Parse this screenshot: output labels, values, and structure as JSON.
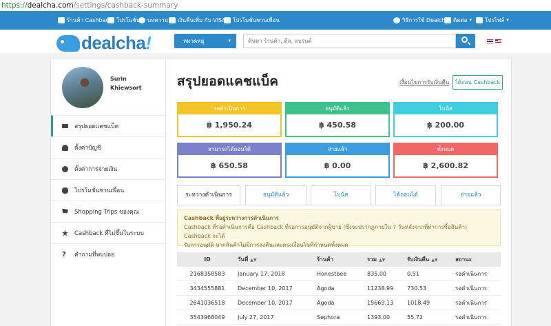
{
  "browser": {
    "url_scheme": "https://",
    "url_host": "dealcha.com",
    "url_path": "/settings/cashback-summary"
  },
  "topnav": {
    "items": [
      {
        "label": "ร้านค้า Cashback",
        "icon": "store-icon"
      },
      {
        "label": "โปรโมชั่น",
        "icon": "tag-icon"
      },
      {
        "label": "บทความ",
        "icon": "bulb-icon"
      },
      {
        "label": "เงินคืนเพิ่ม กับ VISA",
        "icon": "card-icon"
      },
      {
        "label": "โปรโมชั่นชวนเพื่อน",
        "icon": "gift-icon"
      }
    ],
    "right": [
      {
        "label": "วิธีการใช้ Dealcha!",
        "icon": "help-icon"
      },
      {
        "label": "ติดต่อ",
        "icon": "mail-icon"
      },
      {
        "label": "โปรไฟล์",
        "icon": "user-icon"
      }
    ]
  },
  "header": {
    "logo_main": "dealcha",
    "logo_bang": "!",
    "category_label": "หมวดหมู่",
    "search_placeholder": "ค้นหา ร้านค้า, ดีล, แบรนด์"
  },
  "user": {
    "first_name": "Surin",
    "last_name": "Khiewsort"
  },
  "sidebar": {
    "items": [
      {
        "label": "สรุปยอดแคชแบ็ค",
        "icon": "money-icon"
      },
      {
        "label": "ตั้งค่าบัญชี",
        "icon": "user-icon"
      },
      {
        "label": "ตั้งค่าการจ่ายเงิน",
        "icon": "gear-icon"
      },
      {
        "label": "โปรโมชั่นชวนเพื่อน",
        "icon": "chat-icon"
      },
      {
        "label": "Shopping Trips ของคุณ",
        "icon": "cart-icon"
      },
      {
        "label": "Cashback ที่ไม่ขึ้นในระบบ",
        "icon": "asterisk-icon"
      },
      {
        "label": "คำถามที่พบบ่อย",
        "icon": "question-icon"
      }
    ]
  },
  "main": {
    "title": "สรุปยอดแคชแบ็ค",
    "conditions_link": "เงื่อนไขการรับเงินคืน",
    "withdraw_button": "ได้ถอน Cashback"
  },
  "cards": [
    {
      "label": "รอดำเนินการ",
      "value": "฿ 1,950.24",
      "color": "#f2c428"
    },
    {
      "label": "อนุมัติแล้ว",
      "value": "฿ 450.58",
      "color": "#3ec08f"
    },
    {
      "label": "โบนัส",
      "value": "฿ 200.00",
      "color": "#3fcfe0"
    },
    {
      "label": "สามารถได้ถอนได้",
      "value": "฿ 650.58",
      "color": "#7a80c9"
    },
    {
      "label": "จ่ายแล้ว",
      "value": "฿ 0.00",
      "color": "#3b9de0"
    },
    {
      "label": "ทั้งหมด",
      "value": "฿ 2,600.82",
      "color": "#f36666"
    }
  ],
  "tabs": [
    {
      "label": "ระหว่างดำเนินการ",
      "active": true
    },
    {
      "label": "อนุมัติแล้ว"
    },
    {
      "label": "โบนัส"
    },
    {
      "label": "ได้ถอนได้"
    },
    {
      "label": "จ่ายแล้ว"
    }
  ],
  "alert": {
    "title": "Cashback ที่อยู่ระหว่างการดำเนินการ",
    "line1": "Cashback ที่รอดำเนินการคือ Cashback ที่รอการอนุมัติจากผู้ขาย (ซึ่งจะปรากฏภายใน 7 วันหลังจากที่ทำการซื้อสินค้า) Cashback จะได้",
    "line2": "รับการอนุมัติ หากสินค้าไม่มีการส่งคืนและตรงเงื่อนไขที่กำหนดทั้งหมด"
  },
  "table": {
    "headers": {
      "id": "ID",
      "date": "วันที่",
      "store": "ร้านค้า",
      "total": "รวม",
      "refund": "รับเงินคืน",
      "status": "สถานะ"
    },
    "rows": [
      {
        "id": "2168358583",
        "date": "January 17, 2018",
        "store": "Honestbee",
        "total": "835.00",
        "refund": "0.51",
        "status": "รอดำเนินการ"
      },
      {
        "id": "3434555881",
        "date": "December 10, 2017",
        "store": "Agoda",
        "total": "11238.99",
        "refund": "730.53",
        "status": "รอดำเนินการ"
      },
      {
        "id": "2641036518",
        "date": "December 10, 2017",
        "store": "Agoda",
        "total": "15669.13",
        "refund": "1018.49",
        "status": "รอดำเนินการ"
      },
      {
        "id": "3543968049",
        "date": "July 27, 2017",
        "store": "Sephora",
        "total": "1393.00",
        "refund": "55.72",
        "status": "รอดำเนินการ"
      }
    ]
  }
}
